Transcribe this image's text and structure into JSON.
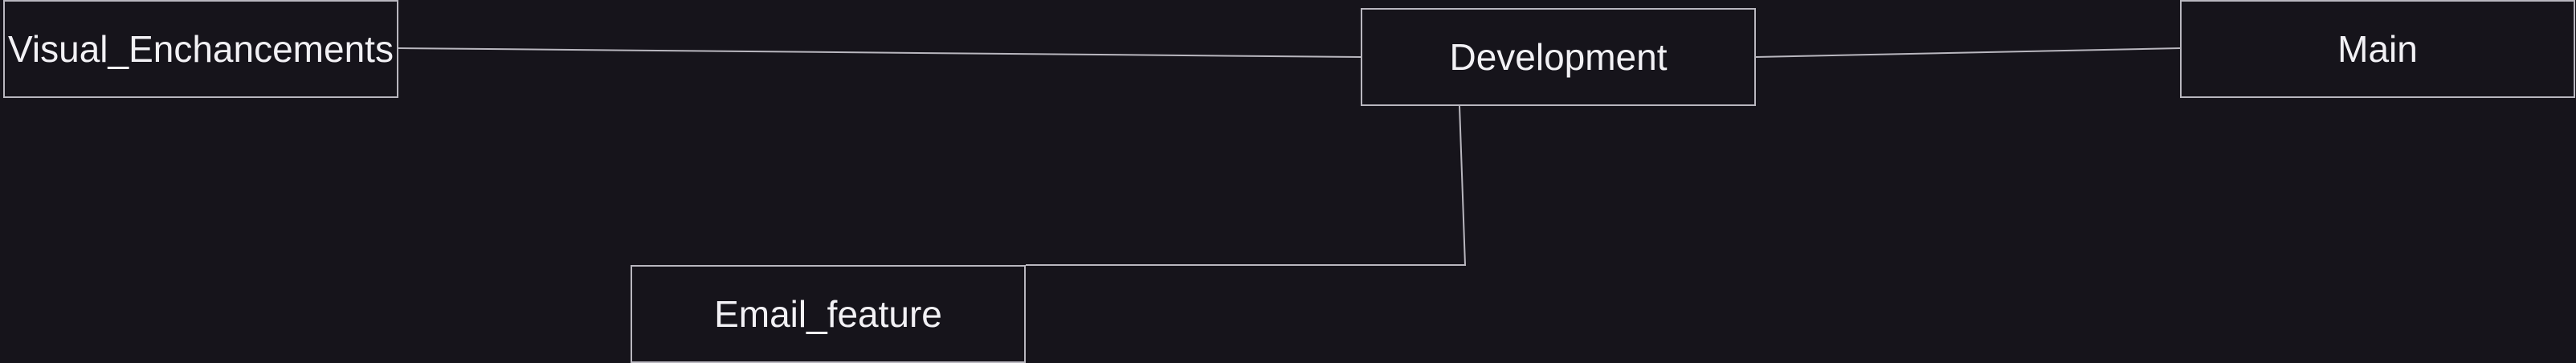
{
  "diagram": {
    "nodes": [
      {
        "id": "visual",
        "label": "Visual_Enchancements"
      },
      {
        "id": "dev",
        "label": "Development"
      },
      {
        "id": "main",
        "label": "Main"
      },
      {
        "id": "email",
        "label": "Email_feature"
      }
    ],
    "edges": [
      {
        "from": "visual",
        "to": "dev"
      },
      {
        "from": "dev",
        "to": "main"
      },
      {
        "from": "dev",
        "to": "email"
      }
    ],
    "colors": {
      "background": "#16141b",
      "border": "#b9b7bf",
      "text": "#f2f1f5"
    }
  }
}
